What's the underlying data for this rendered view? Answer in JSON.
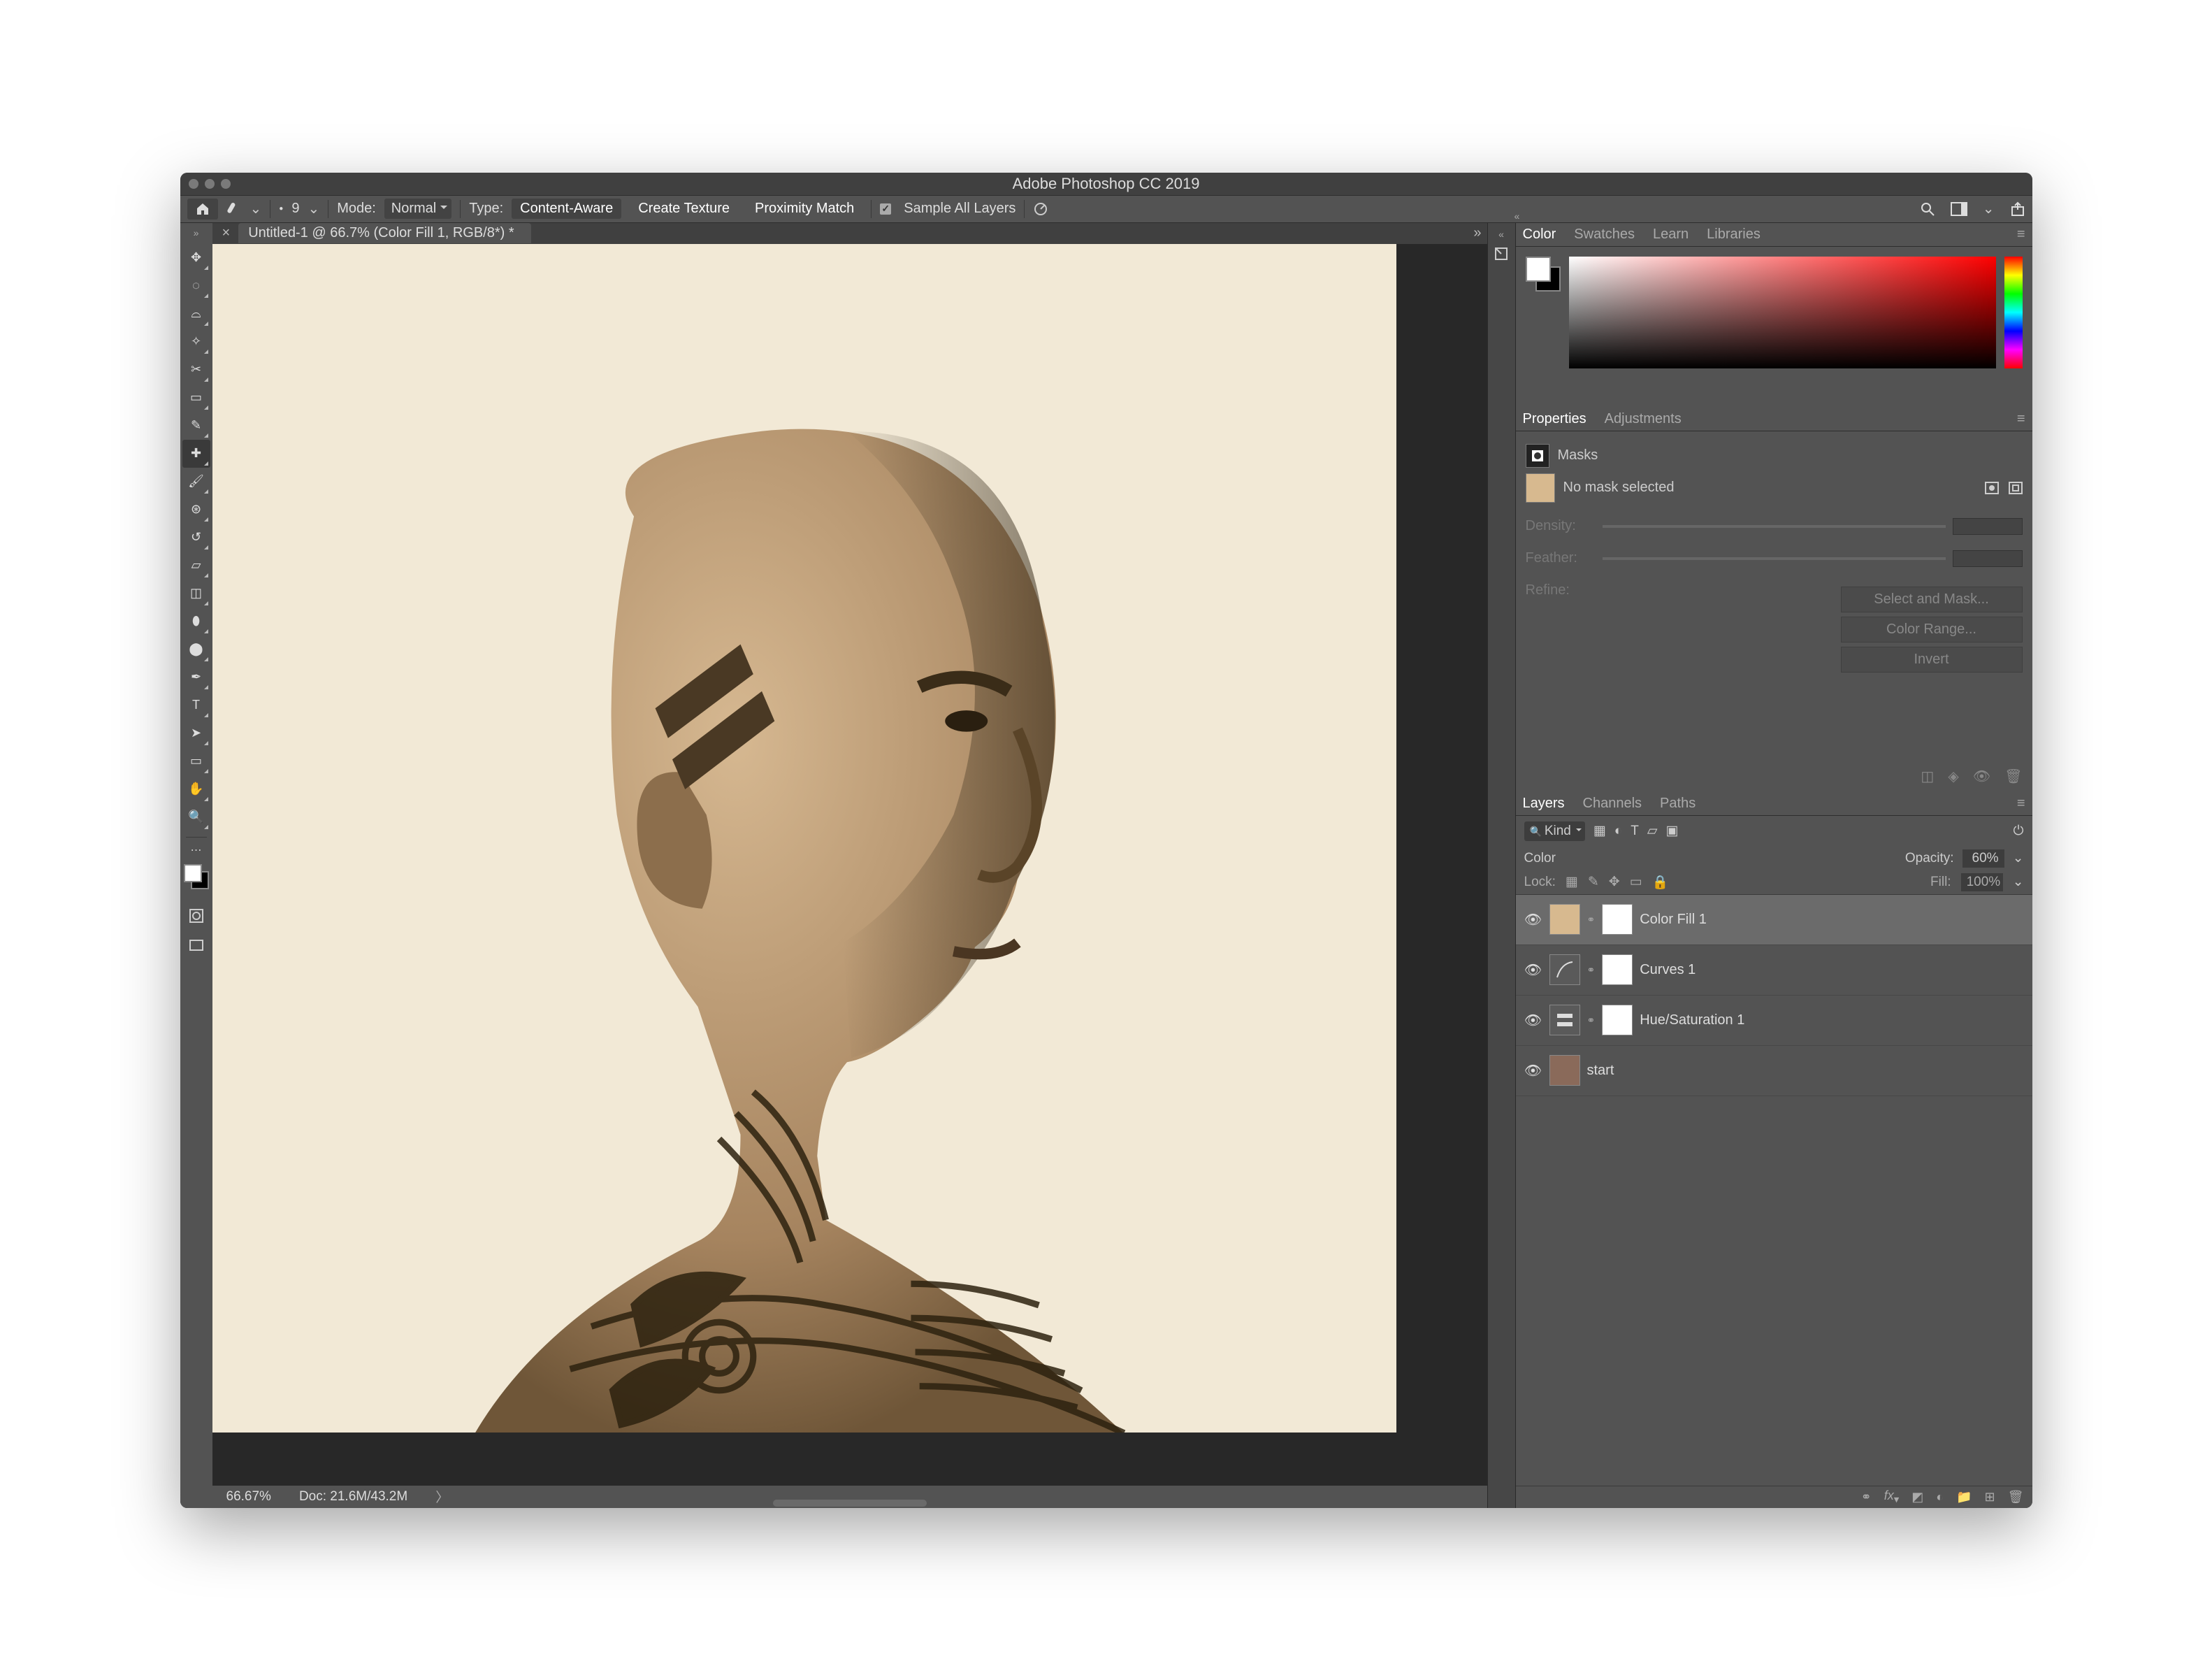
{
  "titlebar": {
    "title": "Adobe Photoshop CC 2019"
  },
  "optbar": {
    "brush_size": "9",
    "mode_label": "Mode:",
    "mode_value": "Normal",
    "type_label": "Type:",
    "type_options": [
      "Content-Aware",
      "Create Texture",
      "Proximity Match"
    ],
    "sample_all_label": "Sample All Layers"
  },
  "doc_tab": {
    "label": "Untitled-1 @ 66.7% (Color Fill 1, RGB/8*) *"
  },
  "tools": [
    {
      "name": "move-tool",
      "glyph": "✥"
    },
    {
      "name": "marquee-tool",
      "glyph": "◌"
    },
    {
      "name": "lasso-tool",
      "glyph": "⌓"
    },
    {
      "name": "quick-select-tool",
      "glyph": "✧"
    },
    {
      "name": "crop-tool",
      "glyph": "✂"
    },
    {
      "name": "frame-tool",
      "glyph": "▭"
    },
    {
      "name": "eyedropper-tool",
      "glyph": "✎"
    },
    {
      "name": "healing-tool",
      "glyph": "✚",
      "selected": true
    },
    {
      "name": "brush-tool",
      "glyph": "🖌"
    },
    {
      "name": "clone-tool",
      "glyph": "⊛"
    },
    {
      "name": "history-brush-tool",
      "glyph": "↺"
    },
    {
      "name": "eraser-tool",
      "glyph": "▱"
    },
    {
      "name": "gradient-tool",
      "glyph": "◫"
    },
    {
      "name": "blur-tool",
      "glyph": "⬮"
    },
    {
      "name": "dodge-tool",
      "glyph": "⬤"
    },
    {
      "name": "pen-tool",
      "glyph": "✒"
    },
    {
      "name": "type-tool",
      "glyph": "T"
    },
    {
      "name": "path-select-tool",
      "glyph": "➤"
    },
    {
      "name": "rectangle-tool",
      "glyph": "▭"
    },
    {
      "name": "hand-tool",
      "glyph": "✋"
    },
    {
      "name": "zoom-tool",
      "glyph": "🔍"
    }
  ],
  "color_tabs": [
    "Color",
    "Swatches",
    "Learn",
    "Libraries"
  ],
  "properties_tabs": [
    "Properties",
    "Adjustments"
  ],
  "properties": {
    "header_label": "Masks",
    "status_text": "No mask selected",
    "density_label": "Density:",
    "feather_label": "Feather:",
    "refine_label": "Refine:",
    "buttons": [
      "Select and Mask...",
      "Color Range...",
      "Invert"
    ]
  },
  "layers_tabs": [
    "Layers",
    "Channels",
    "Paths"
  ],
  "layers_panel": {
    "filter_label": "Kind",
    "blend_mode": "Color",
    "opacity_label": "Opacity:",
    "opacity_value": "60%",
    "lock_label": "Lock:",
    "fill_label": "Fill:",
    "fill_value": "100%",
    "layers": [
      {
        "name": "Color Fill 1",
        "type": "fill",
        "active": true
      },
      {
        "name": "Curves 1",
        "type": "curves"
      },
      {
        "name": "Hue/Saturation 1",
        "type": "huesat"
      },
      {
        "name": "start",
        "type": "image"
      }
    ]
  },
  "status": {
    "zoom": "66.67%",
    "doc": "Doc: 21.6M/43.2M"
  },
  "colors": {
    "sepia_fill": "#d7b98f",
    "canvas_bg": "#f2e9d6"
  }
}
